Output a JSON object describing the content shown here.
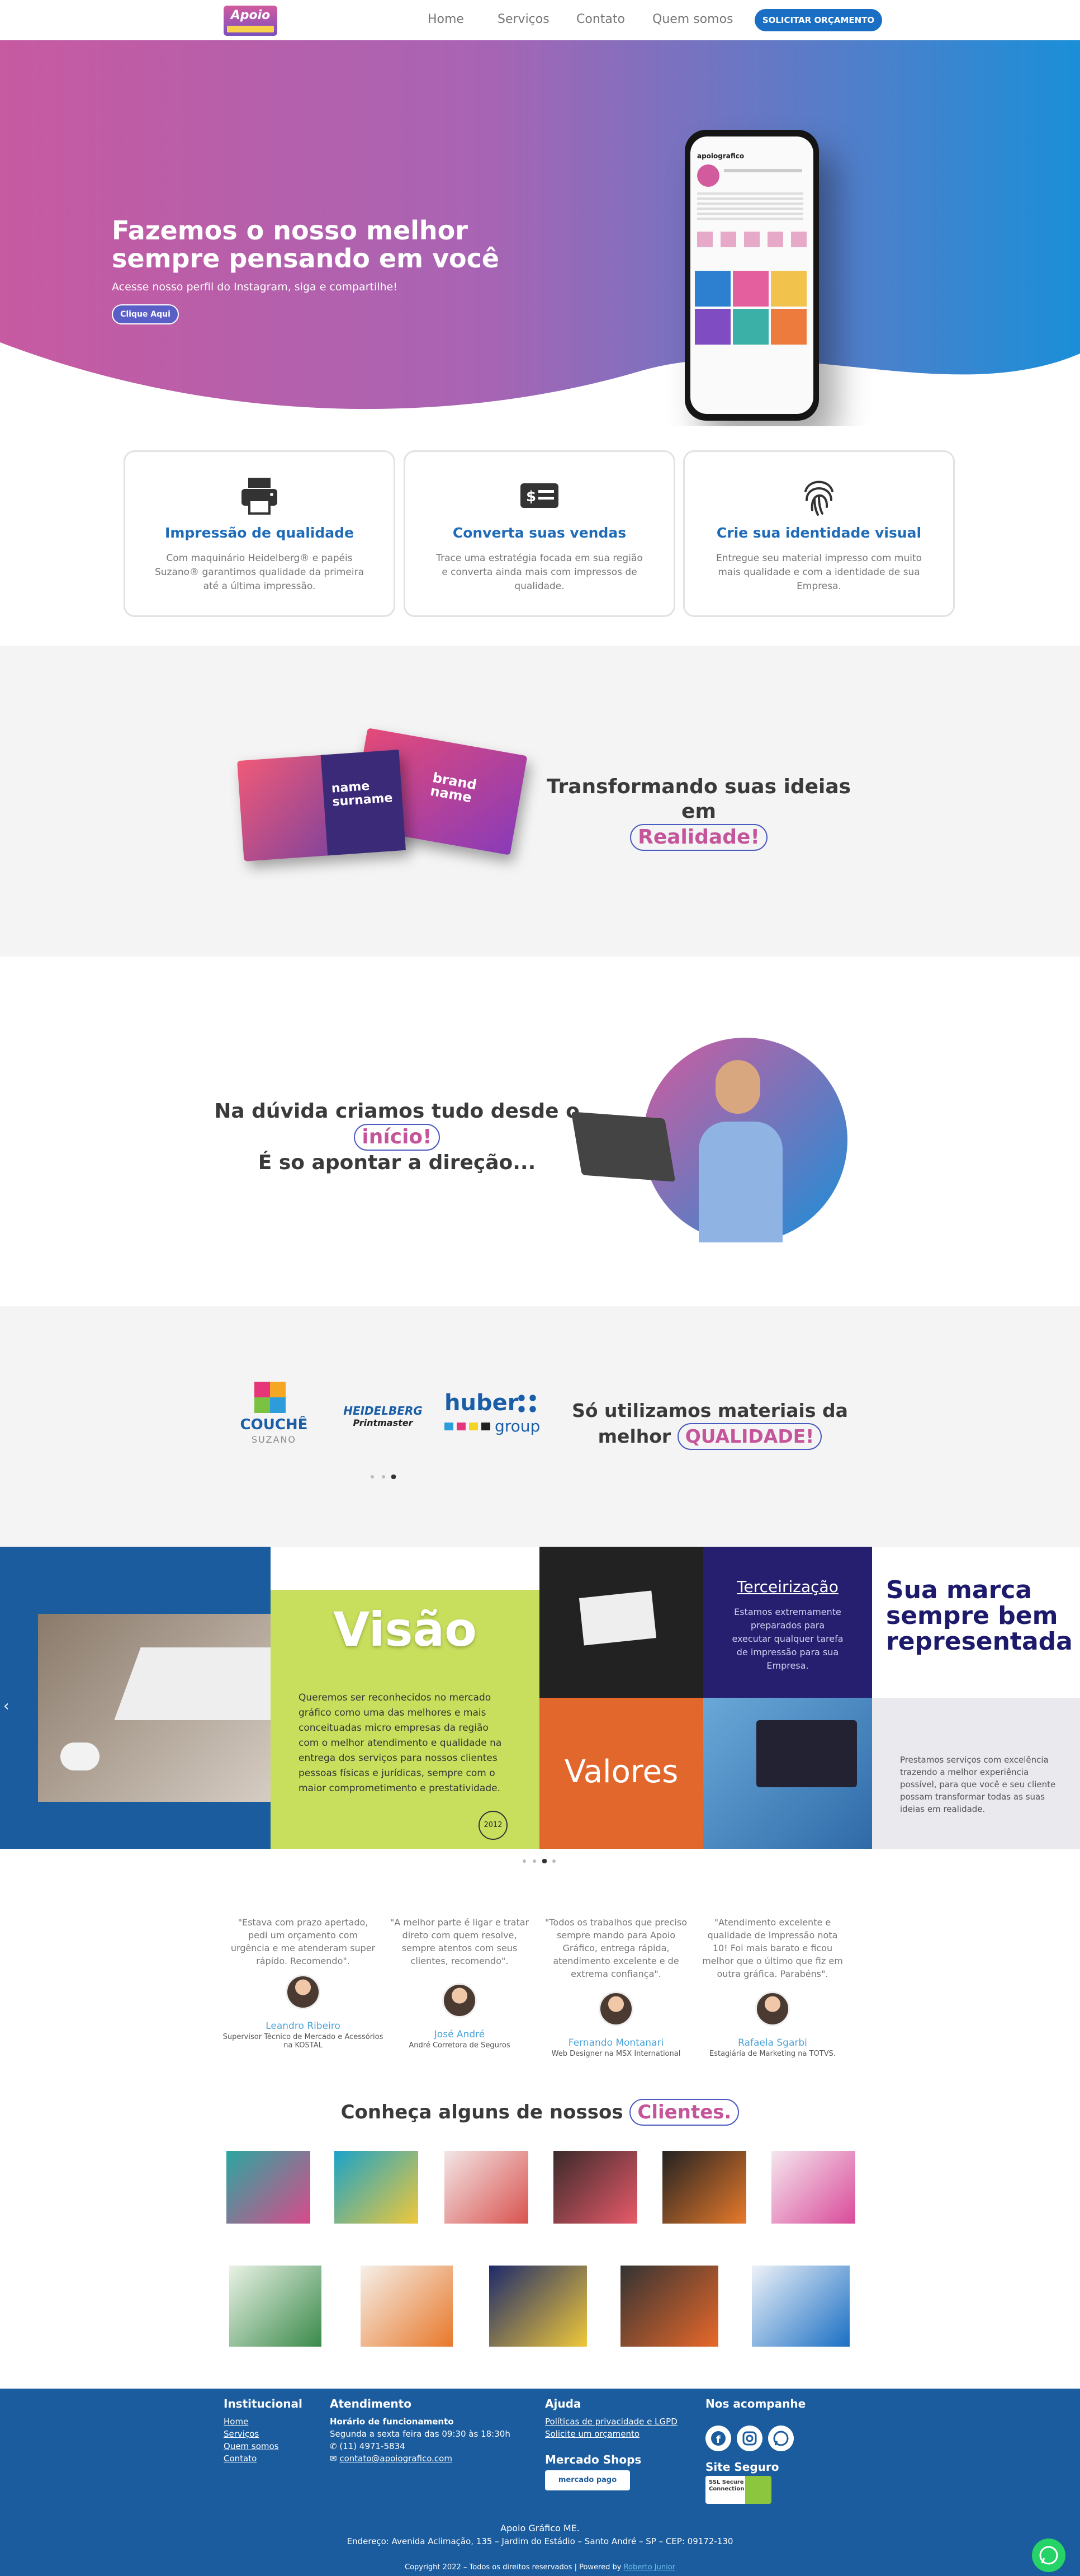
{
  "header": {
    "logo_text": "Apoio",
    "nav": [
      "Home",
      "Serviços",
      "Contato",
      "Quem somos"
    ],
    "cta": "SOLICITAR ORÇAMENTO"
  },
  "hero": {
    "title": "Fazemos o nosso melhor sempre pensando em você",
    "subtitle": "Acesse nosso perfil do Instagram, siga e compartilhe!",
    "button": "Clique Aqui",
    "phone_handle": "apoiografico"
  },
  "features": [
    {
      "icon": "printer-icon",
      "title": "Impressão de qualidade",
      "text": "Com maquinário Heidelberg® e papéis Suzano® garantimos qualidade da primeira até a última impressão."
    },
    {
      "icon": "money-icon",
      "title": "Converta suas vendas",
      "text": "Trace uma estratégia focada em sua região e converta ainda mais com impressos de qualidade."
    },
    {
      "icon": "fingerprint-icon",
      "title": "Crie sua identidade visual",
      "text": "Entregue seu material impresso com muito mais qualidade e com a identidade de sua Empresa."
    }
  ],
  "ideas": {
    "line1": "Transformando suas ideias em",
    "highlight": "Realidade!",
    "card_front": "name surname",
    "card_back": "brand name"
  },
  "direction": {
    "line1": "Na dúvida criamos tudo desde o",
    "highlight": "início!",
    "line2": "É so apontar a direção..."
  },
  "materials": {
    "line1": "Só utilizamos materiais da",
    "line2_prefix": "melhor",
    "highlight": "QUALIDADE!",
    "logos": [
      "COUCHÊ",
      "SUZANO",
      "HEIDELBERG",
      "Printmaster",
      "huber",
      "group"
    ]
  },
  "mission": {
    "vision_title": "Visão",
    "vision_text": "Queremos ser reconhecidos no mercado gráfico como uma das melhores e mais conceituadas micro empresas da região com o melhor atendimento e qualidade na entrega dos serviços para nossos clientes pessoas físicas e jurídicas, sempre com o maior comprometimento e prestatividade.",
    "vision_badge": "2012",
    "outsource_title": "Terceirização",
    "outsource_text": "Estamos extremamente preparados para executar qualquer tarefa de impressão para sua Empresa.",
    "brand_title": "Sua marca sempre bem representada",
    "values_title": "Valores",
    "values_text": "Prestamos serviços com excelência trazendo a melhor experiência possível, para que você e seu cliente possam transformar todas as suas ideias em realidade."
  },
  "testimonials": [
    {
      "quote": "\"Estava com prazo apertado, pedi um orçamento com urgência e me atenderam super rápido. Recomendo\".",
      "name": "Leandro Ribeiro",
      "role": "Supervisor Técnico de Mercado e Acessórios na KOSTAL"
    },
    {
      "quote": "\"A melhor parte é ligar e tratar direto com quem resolve, sempre atentos com seus clientes, recomendo\".",
      "name": "José André",
      "role": "André Corretora de Seguros"
    },
    {
      "quote": "\"Todos os trabalhos que preciso sempre mando para Apoio Gráfico, entrega rápida, atendimento excelente e de extrema confiança\".",
      "name": "Fernando Montanari",
      "role": "Web Designer na MSX International"
    },
    {
      "quote": "\"Atendimento excelente e qualidade de impressão nota 10! Foi mais barato e ficou melhor que o último que fiz em outra gráfica. Parabéns\".",
      "name": "Rafaela Sgarbi",
      "role": "Estagiária de Marketing na TOTVS."
    }
  ],
  "clients": {
    "prefix": "Conheça alguns de nossos",
    "highlight": "Clientes."
  },
  "footer": {
    "inst_title": "Institucional",
    "inst_links": [
      "Home",
      "Serviços",
      "Quem somos",
      "Contato"
    ],
    "att_title": "Atendimento",
    "hours_title": "Horário de funcionamento",
    "hours": "Segunda a sexta feira das 09:30 às 18:30h",
    "phone": "(11) 4971-5834",
    "email": "contato@apoiografico.com",
    "help_title": "Ajuda",
    "help_links": [
      "Políticas de privacidade e LGPD",
      "Solicite um orçamento"
    ],
    "shops_title": "Mercado Shops",
    "shops_badge": "mercado pago",
    "follow_title": "Nos acompanhe",
    "secure_title": "Site Seguro",
    "ssl_badge": "SSL Secure Connection",
    "company": "Apoio Gráfico ME.",
    "address": "Endereço: Avenida Aclimação, 135 – Jardim do Estádio – Santo André – SP – CEP: 09172-130",
    "copyright": "Copyright 2022 – Todos os direitos reservados | Powered by",
    "powered": "Roberto Junior"
  }
}
